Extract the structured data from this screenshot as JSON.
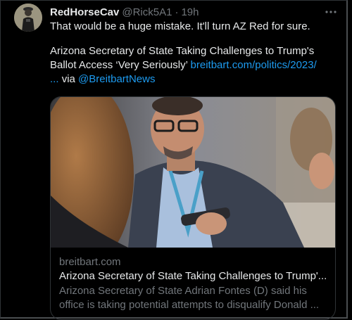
{
  "tweet": {
    "display_name": "RedHorseCav",
    "handle": "@Rick5A1",
    "separator": "·",
    "time": "19h",
    "more_icon": "more-horizontal-icon",
    "text_line_1": "That would be a huge mistake.  It'll turn AZ Red for sure.",
    "headline_line_1": "Arizona Secretary of State Taking Challenges to Trump's",
    "headline_line_2": "Ballot Access ‘Very Seriously’",
    "link_url": "breitbart.com/politics/2023/",
    "link_ellipsis": "...",
    "via_text": "via",
    "via_mention": "@BreitbartNews"
  },
  "card": {
    "domain": "breitbart.com",
    "title": "Arizona Secretary of State Taking Challenges to Trump'...",
    "description_line_1": "Arizona Secretary of State Adrian Fontes (D) said his",
    "description_line_2": "office is taking potential attempts to disqualify Donald ..."
  },
  "colors": {
    "background": "#000000",
    "text": "#e7e9ea",
    "secondary": "#71767b",
    "link": "#1d9bf0",
    "border": "#2f3336"
  }
}
